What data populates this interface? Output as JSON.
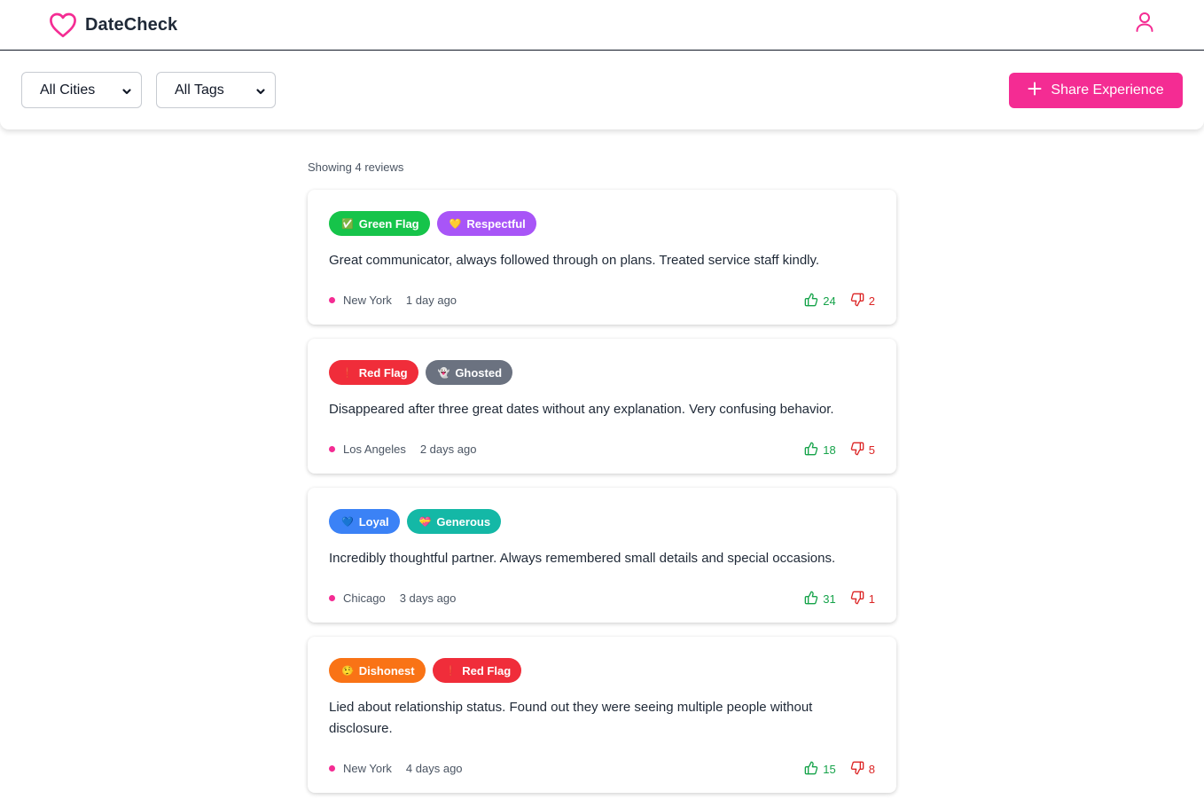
{
  "app": {
    "name": "DateCheck"
  },
  "filters": {
    "city": {
      "selected": "All Cities"
    },
    "tag": {
      "selected": "All Tags"
    },
    "share_label": "Share Experience"
  },
  "summary": "Showing 4 reviews",
  "colors": {
    "brand": "#f42c93",
    "upvote": "#16a34a",
    "downvote": "#dc2626"
  },
  "reviews": [
    {
      "tags": [
        {
          "emoji": "✅",
          "label": "Green Flag",
          "color": "#16c44a"
        },
        {
          "emoji": "💛",
          "label": "Respectful",
          "color": "#a855f7"
        }
      ],
      "text": "Great communicator, always followed through on plans. Treated service staff kindly.",
      "city": "New York",
      "time": "1 day ago",
      "upvotes": "24",
      "downvotes": "2"
    },
    {
      "tags": [
        {
          "emoji": "❗",
          "label": "Red Flag",
          "color": "#f02d3a"
        },
        {
          "emoji": "👻",
          "label": "Ghosted",
          "color": "#6b7280"
        }
      ],
      "text": "Disappeared after three great dates without any explanation. Very confusing behavior.",
      "city": "Los Angeles",
      "time": "2 days ago",
      "upvotes": "18",
      "downvotes": "5"
    },
    {
      "tags": [
        {
          "emoji": "💙",
          "label": "Loyal",
          "color": "#3b82f6"
        },
        {
          "emoji": "💝",
          "label": "Generous",
          "color": "#14b8a6"
        }
      ],
      "text": "Incredibly thoughtful partner. Always remembered small details and special occasions.",
      "city": "Chicago",
      "time": "3 days ago",
      "upvotes": "31",
      "downvotes": "1"
    },
    {
      "tags": [
        {
          "emoji": "🤥",
          "label": "Dishonest",
          "color": "#f97316"
        },
        {
          "emoji": "❗",
          "label": "Red Flag",
          "color": "#f02d3a"
        }
      ],
      "text": "Lied about relationship status. Found out they were seeing multiple people without disclosure.",
      "city": "New York",
      "time": "4 days ago",
      "upvotes": "15",
      "downvotes": "8"
    }
  ]
}
